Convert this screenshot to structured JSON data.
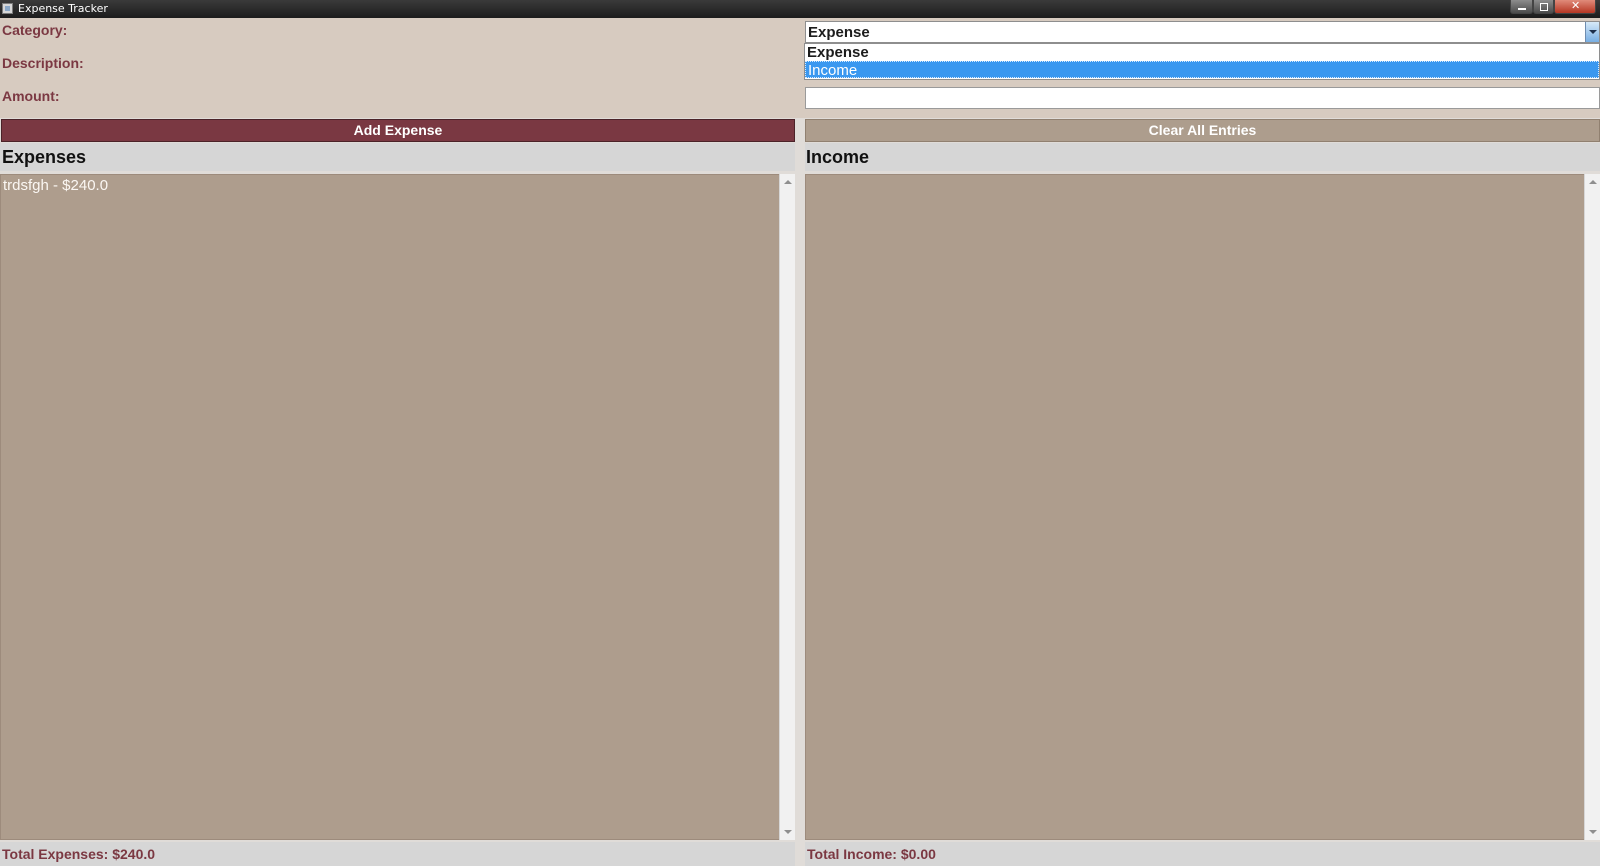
{
  "window": {
    "title": "Expense Tracker"
  },
  "form": {
    "category_label": "Category:",
    "description_label": "Description:",
    "amount_label": "Amount:",
    "category_selected": "Expense",
    "category_options": [
      "Expense",
      "Income"
    ],
    "category_highlighted": "Income",
    "amount_value": ""
  },
  "buttons": {
    "add": "Add Expense",
    "clear": "Clear All Entries"
  },
  "expenses": {
    "title": "Expenses",
    "items": [
      "trdsfgh - $240.0"
    ],
    "total": "Total Expenses: $240.0"
  },
  "income": {
    "title": "Income",
    "items": [],
    "total": "Total Income: $0.00"
  },
  "colors": {
    "accent": "#7a3842",
    "panel": "#ae9d8d",
    "selection": "#3a98f0"
  },
  "icons": {
    "app": "window-app-icon",
    "minimize": "minimize-icon",
    "maximize": "maximize-icon",
    "close": "close-icon",
    "dropdown": "chevron-down-icon"
  }
}
